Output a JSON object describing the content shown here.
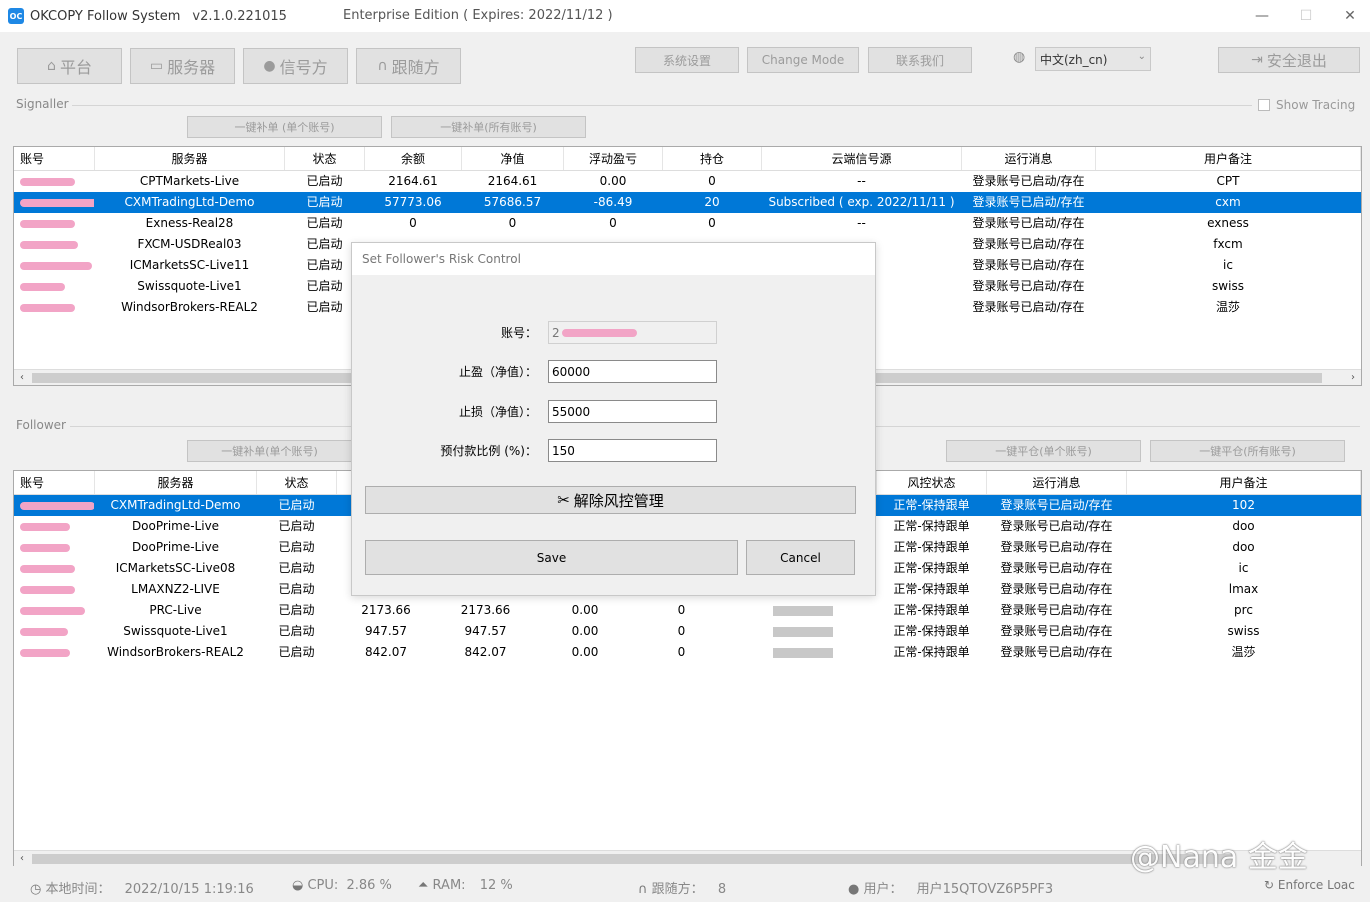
{
  "window": {
    "app_name": "OKCOPY Follow System",
    "version": "v2.1.0.221015",
    "edition": "Enterprise Edition ( Expires: 2022/11/12 )",
    "logo_text": "OC"
  },
  "toolbar": {
    "platform": "平台",
    "servers": "服务器",
    "signaller": "信号方",
    "follower": "跟随方",
    "system_settings": "系统设置",
    "change_mode": "Change Mode",
    "contact_us": "联系我们",
    "language": "中文(zh_cn)",
    "logout": "安全退出"
  },
  "signaller": {
    "group_label": "Signaller",
    "show_tracing": "Show Tracing",
    "btn_single": "一键补单 (单个账号)",
    "btn_all": "一键补单(所有账号)",
    "columns": [
      "账号",
      "服务器",
      "状态",
      "余额",
      "净值",
      "浮动盈亏",
      "持仓",
      "云端信号源",
      "运行消息",
      "用户备注"
    ],
    "rows": [
      {
        "server": "CPTMarkets-Live",
        "status": "已启动",
        "balance": "2164.61",
        "equity": "2164.61",
        "pnl": "0.00",
        "positions": "0",
        "cloud": "--",
        "message": "登录账号已启动/存在",
        "note": "CPT"
      },
      {
        "server": "CXMTradingLtd-Demo",
        "status": "已启动",
        "balance": "57773.06",
        "equity": "57686.57",
        "pnl": "-86.49",
        "positions": "20",
        "cloud": "Subscribed ( exp. 2022/11/11 )",
        "message": "登录账号已启动/存在",
        "note": "cxm"
      },
      {
        "server": "Exness-Real28",
        "status": "已启动",
        "balance": "0",
        "equity": "0",
        "pnl": "0",
        "positions": "0",
        "cloud": "--",
        "message": "登录账号已启动/存在",
        "note": "exness"
      },
      {
        "server": "FXCM-USDReal03",
        "status": "已启动",
        "balance": "",
        "equity": "",
        "pnl": "",
        "positions": "",
        "cloud": "",
        "message": "登录账号已启动/存在",
        "note": "fxcm"
      },
      {
        "server": "ICMarketsSC-Live11",
        "status": "已启动",
        "balance": "",
        "equity": "",
        "pnl": "",
        "positions": "",
        "cloud": "",
        "message": "登录账号已启动/存在",
        "note": "ic"
      },
      {
        "server": "Swissquote-Live1",
        "status": "已启动",
        "balance": "",
        "equity": "",
        "pnl": "",
        "positions": "",
        "cloud": "",
        "message": "登录账号已启动/存在",
        "note": "swiss"
      },
      {
        "server": "WindsorBrokers-REAL2",
        "status": "已启动",
        "balance": "",
        "equity": "",
        "pnl": "",
        "positions": "",
        "cloud": "",
        "message": "登录账号已启动/存在",
        "note": "温莎"
      }
    ]
  },
  "follower": {
    "group_label": "Follower",
    "btn_single": "一键补单(单个账号)",
    "btn_close_single": "一键平仓(单个账号)",
    "btn_close_all": "一键平仓(所有账号)",
    "columns": [
      "账号",
      "服务器",
      "状态",
      "风控状态",
      "运行消息",
      "用户备注"
    ],
    "rows": [
      {
        "server": "CXMTradingLtd-Demo",
        "status": "已启动",
        "balance": "",
        "equity": "",
        "pnl": "",
        "positions": "",
        "risk": "正常-保持跟单",
        "message": "登录账号已启动/存在",
        "note": "102"
      },
      {
        "server": "DooPrime-Live",
        "status": "已启动",
        "balance": "",
        "equity": "",
        "pnl": "",
        "positions": "",
        "risk": "正常-保持跟单",
        "message": "登录账号已启动/存在",
        "note": "doo"
      },
      {
        "server": "DooPrime-Live",
        "status": "已启动",
        "balance": "",
        "equity": "",
        "pnl": "",
        "positions": "",
        "risk": "正常-保持跟单",
        "message": "登录账号已启动/存在",
        "note": "doo"
      },
      {
        "server": "ICMarketsSC-Live08",
        "status": "已启动",
        "balance": "",
        "equity": "",
        "pnl": "",
        "positions": "",
        "risk": "正常-保持跟单",
        "message": "登录账号已启动/存在",
        "note": "ic"
      },
      {
        "server": "LMAXNZ2-LIVE",
        "status": "已启动",
        "balance": "",
        "equity": "",
        "pnl": "",
        "positions": "",
        "risk": "正常-保持跟单",
        "message": "登录账号已启动/存在",
        "note": "lmax"
      },
      {
        "server": "PRC-Live",
        "status": "已启动",
        "balance": "2173.66",
        "equity": "2173.66",
        "pnl": "0.00",
        "positions": "0",
        "risk": "正常-保持跟单",
        "message": "登录账号已启动/存在",
        "note": "prc"
      },
      {
        "server": "Swissquote-Live1",
        "status": "已启动",
        "balance": "947.57",
        "equity": "947.57",
        "pnl": "0.00",
        "positions": "0",
        "risk": "正常-保持跟单",
        "message": "登录账号已启动/存在",
        "note": "swiss"
      },
      {
        "server": "WindsorBrokers-REAL2",
        "status": "已启动",
        "balance": "842.07",
        "equity": "842.07",
        "pnl": "0.00",
        "positions": "0",
        "risk": "正常-保持跟单",
        "message": "登录账号已启动/存在",
        "note": "温莎"
      }
    ]
  },
  "modal": {
    "title": "Set Follower's Risk Control",
    "account_label": "账号：",
    "account_value": "2",
    "take_profit_label": "止盈（净值）：",
    "take_profit_value": "60000",
    "stop_loss_label": "止损（净值）：",
    "stop_loss_value": "55000",
    "prepay_label": "预付款比例 (%)：",
    "prepay_value": "150",
    "remove_risk": "解除风控管理",
    "save": "Save",
    "cancel": "Cancel"
  },
  "status": {
    "local_time_label": "本地时间：",
    "local_time": "2022/10/15 1:19:16",
    "cpu_label": "CPU:",
    "cpu": "2.86 %",
    "ram_label": "RAM:",
    "ram": "12 %",
    "followers_label": "跟随方：",
    "followers": "8",
    "user_label": "用户：",
    "user": "用户15QTOVZ6P5PF3",
    "enforce": "Enforce Loac"
  },
  "watermark": "@Nana 金金",
  "colors": {
    "selection": "#0078d7",
    "redaction": "#f2a4c6"
  }
}
